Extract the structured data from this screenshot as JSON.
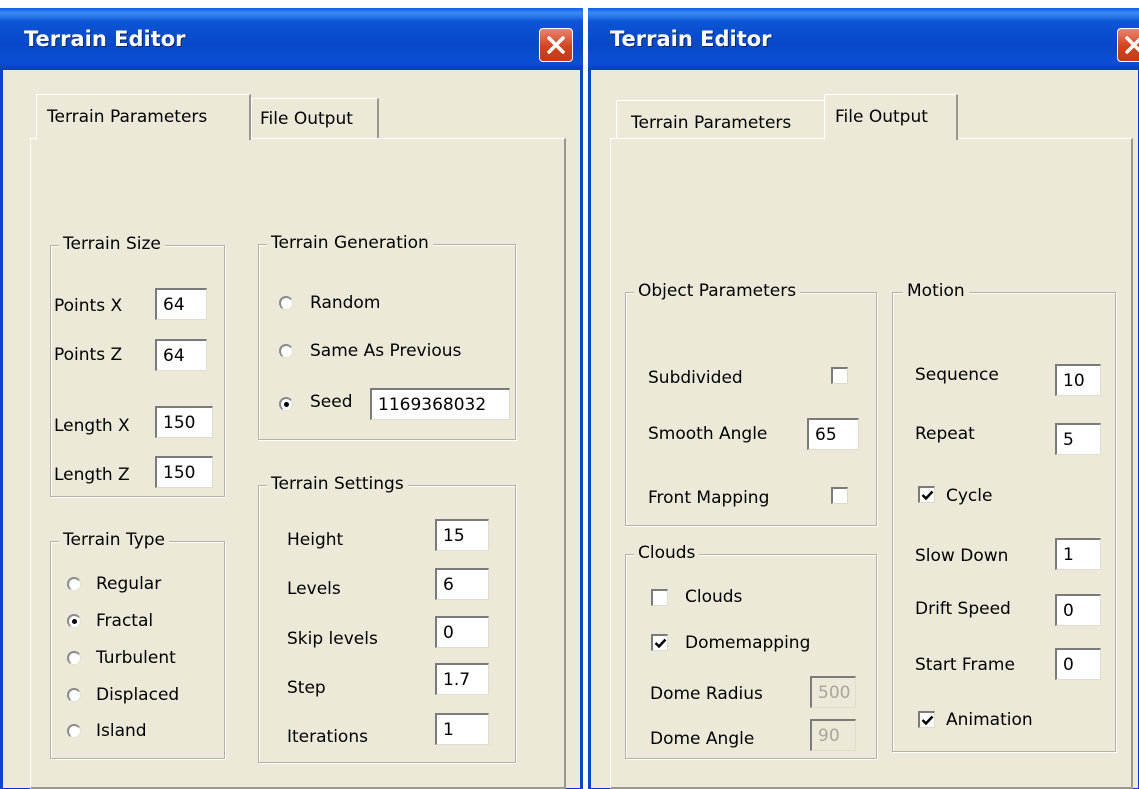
{
  "left": {
    "title": "Terrain Editor",
    "tabs": [
      "Terrain Parameters",
      "File Output"
    ],
    "terrain_size": {
      "legend": "Terrain Size",
      "fields": [
        {
          "label": "Points X",
          "value": "64"
        },
        {
          "label": "Points Z",
          "value": "64"
        },
        {
          "label": "Length X",
          "value": "150"
        },
        {
          "label": "Length Z",
          "value": "150"
        }
      ]
    },
    "terrain_generation": {
      "legend": "Terrain Generation",
      "options": [
        {
          "label": "Random",
          "selected": false
        },
        {
          "label": "Same As Previous",
          "selected": false
        },
        {
          "label": "Seed",
          "selected": true
        }
      ],
      "seed_value": "1169368032"
    },
    "terrain_type": {
      "legend": "Terrain Type",
      "options": [
        {
          "label": "Regular",
          "selected": false
        },
        {
          "label": "Fractal",
          "selected": true
        },
        {
          "label": "Turbulent",
          "selected": false
        },
        {
          "label": "Displaced",
          "selected": false
        },
        {
          "label": "Island",
          "selected": false
        }
      ]
    },
    "terrain_settings": {
      "legend": "Terrain Settings",
      "fields": [
        {
          "label": "Height",
          "value": "15"
        },
        {
          "label": "Levels",
          "value": "6"
        },
        {
          "label": "Skip levels",
          "value": "0"
        },
        {
          "label": "Step",
          "value": "1.7"
        },
        {
          "label": "Iterations",
          "value": "1"
        }
      ]
    }
  },
  "right": {
    "title": "Terrain Editor",
    "tabs": [
      "Terrain Parameters",
      "File Output"
    ],
    "object_parameters": {
      "legend": "Object Parameters",
      "subdivided": {
        "label": "Subdivided",
        "checked": false
      },
      "smooth_angle": {
        "label": "Smooth Angle",
        "value": "65"
      },
      "front_mapping": {
        "label": "Front Mapping",
        "checked": false
      }
    },
    "clouds": {
      "legend": "Clouds",
      "clouds_check": {
        "label": "Clouds",
        "checked": false
      },
      "domemapping_check": {
        "label": "Domemapping",
        "checked": true
      },
      "dome_radius": {
        "label": "Dome Radius",
        "value": "500"
      },
      "dome_angle": {
        "label": "Dome Angle",
        "value": "90"
      }
    },
    "motion": {
      "legend": "Motion",
      "sequence": {
        "label": "Sequence",
        "value": "10"
      },
      "repeat": {
        "label": "Repeat",
        "value": "5"
      },
      "cycle": {
        "label": "Cycle",
        "checked": true
      },
      "slow_down": {
        "label": "Slow Down",
        "value": "1"
      },
      "drift_speed": {
        "label": "Drift Speed",
        "value": "0"
      },
      "start_frame": {
        "label": "Start Frame",
        "value": "0"
      },
      "animation": {
        "label": "Animation",
        "checked": true
      }
    }
  }
}
